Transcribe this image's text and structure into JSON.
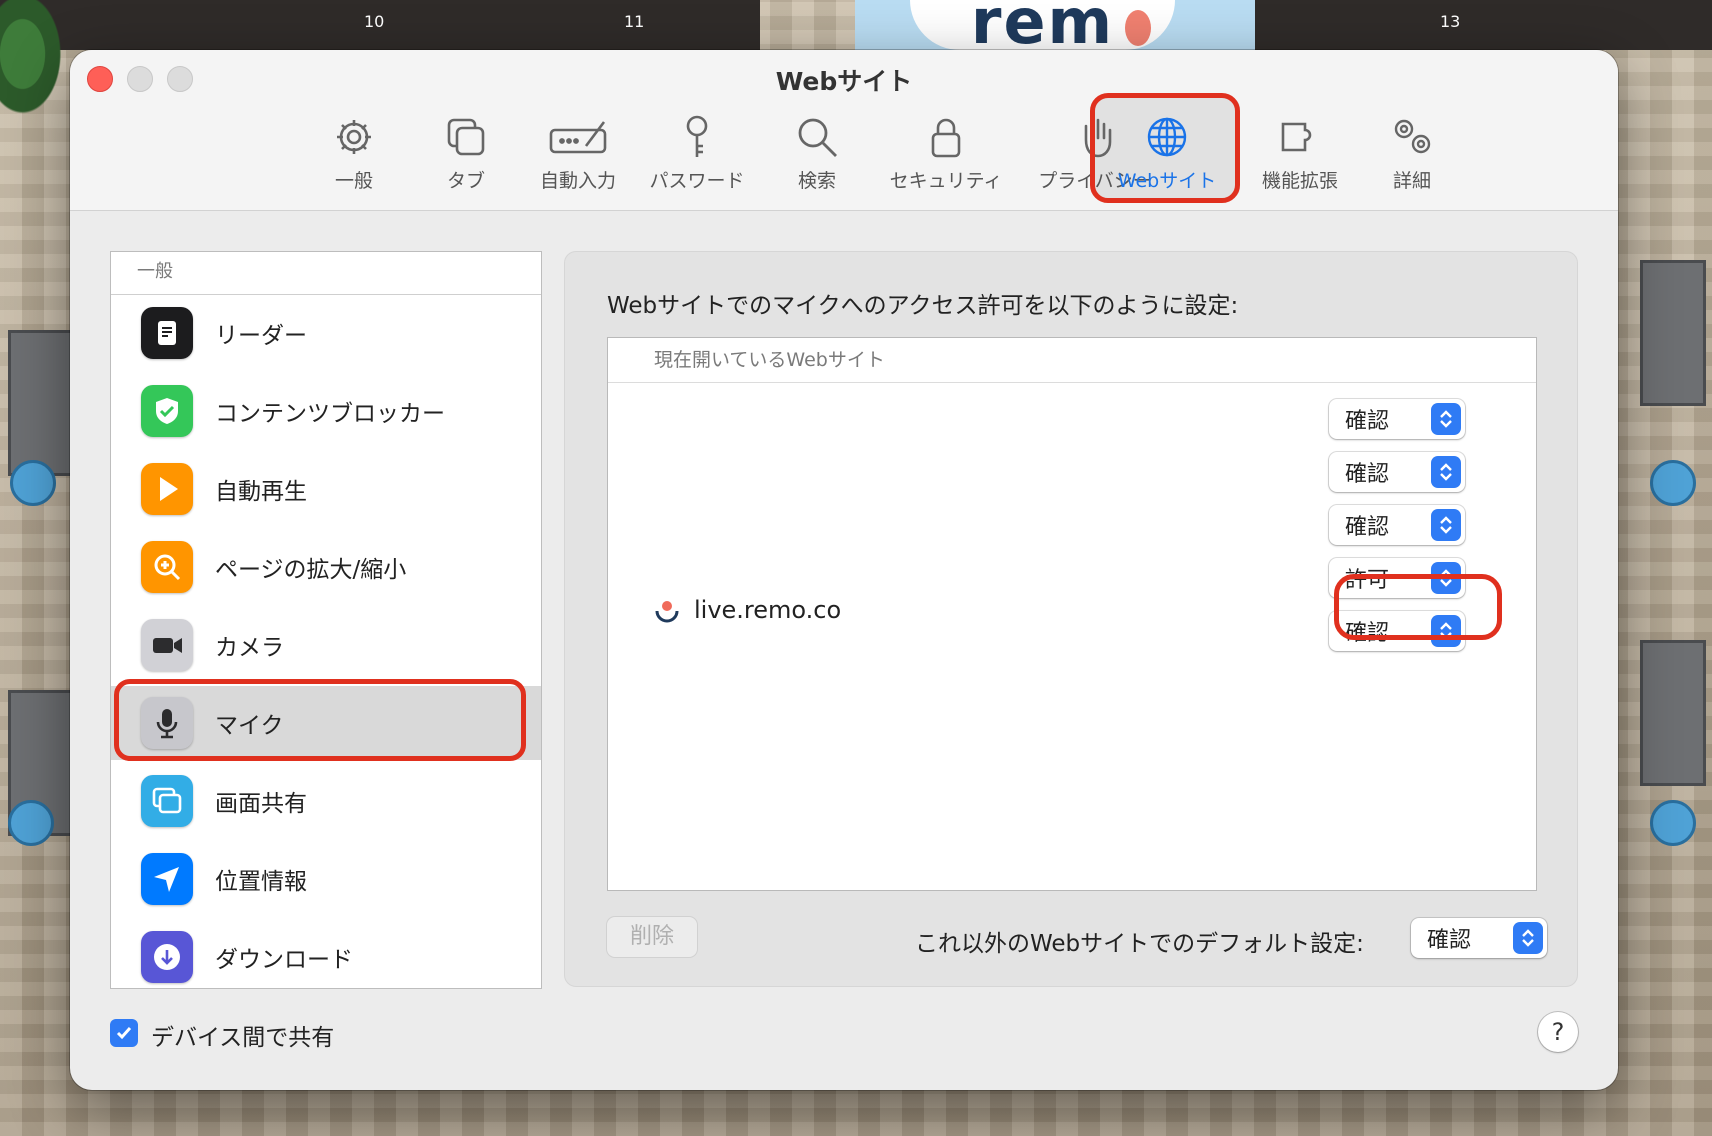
{
  "background": {
    "numbers": [
      "10",
      "11",
      "13"
    ],
    "logo_text": "rem"
  },
  "window": {
    "title": "Webサイト",
    "traffic_lights": [
      "close-button",
      "minimize-button",
      "zoom-button"
    ]
  },
  "toolbar": {
    "items": [
      {
        "label": "一般",
        "icon": "gear-icon"
      },
      {
        "label": "タブ",
        "icon": "tabs-icon"
      },
      {
        "label": "自動入力",
        "icon": "autofill-icon"
      },
      {
        "label": "パスワード",
        "icon": "key-icon"
      },
      {
        "label": "検索",
        "icon": "search-icon"
      },
      {
        "label": "セキュリティ",
        "icon": "lock-icon"
      },
      {
        "label": "プライバシー",
        "icon": "hand-icon"
      },
      {
        "label": "Webサイト",
        "icon": "globe-icon",
        "active": true
      },
      {
        "label": "機能拡張",
        "icon": "puzzle-icon"
      },
      {
        "label": "詳細",
        "icon": "gears-icon"
      }
    ]
  },
  "sidebar": {
    "header": "一般",
    "items": [
      {
        "label": "リーダー",
        "icon": "reader-icon",
        "color": "#1c1c1e"
      },
      {
        "label": "コンテンツブロッカー",
        "icon": "shield-check-icon",
        "color": "#34c759"
      },
      {
        "label": "自動再生",
        "icon": "play-icon",
        "color": "#ff9500"
      },
      {
        "label": "ページの拡大/縮小",
        "icon": "zoom-icon",
        "color": "#ff9500"
      },
      {
        "label": "カメラ",
        "icon": "camera-icon",
        "color": "#8e8e93"
      },
      {
        "label": "マイク",
        "icon": "microphone-icon",
        "color": "#8e8e93",
        "selected": true
      },
      {
        "label": "画面共有",
        "icon": "screen-share-icon",
        "color": "#32ade6"
      },
      {
        "label": "位置情報",
        "icon": "location-icon",
        "color": "#007aff"
      },
      {
        "label": "ダウンロード",
        "icon": "download-icon",
        "color": "#5856d6"
      }
    ]
  },
  "panel": {
    "description": "Webサイトでのマイクへのアクセス許可を以下のように設定:",
    "table_header": "現在開いているWebサイト",
    "site": {
      "name": "live.remo.co",
      "icon": "remo-icon"
    },
    "popups": [
      {
        "value": "確認"
      },
      {
        "value": "確認"
      },
      {
        "value": "確認"
      },
      {
        "value": "許可"
      },
      {
        "value": "確認"
      }
    ],
    "delete_label": "削除",
    "default_label": "これ以外のWebサイトでのデフォルト設定:",
    "default_value": "確認"
  },
  "footer": {
    "share_label": "デバイス間で共有",
    "share_checked": true,
    "help": "?"
  },
  "colors": {
    "accent": "#2f7bf5",
    "highlight": "#e0301e"
  }
}
